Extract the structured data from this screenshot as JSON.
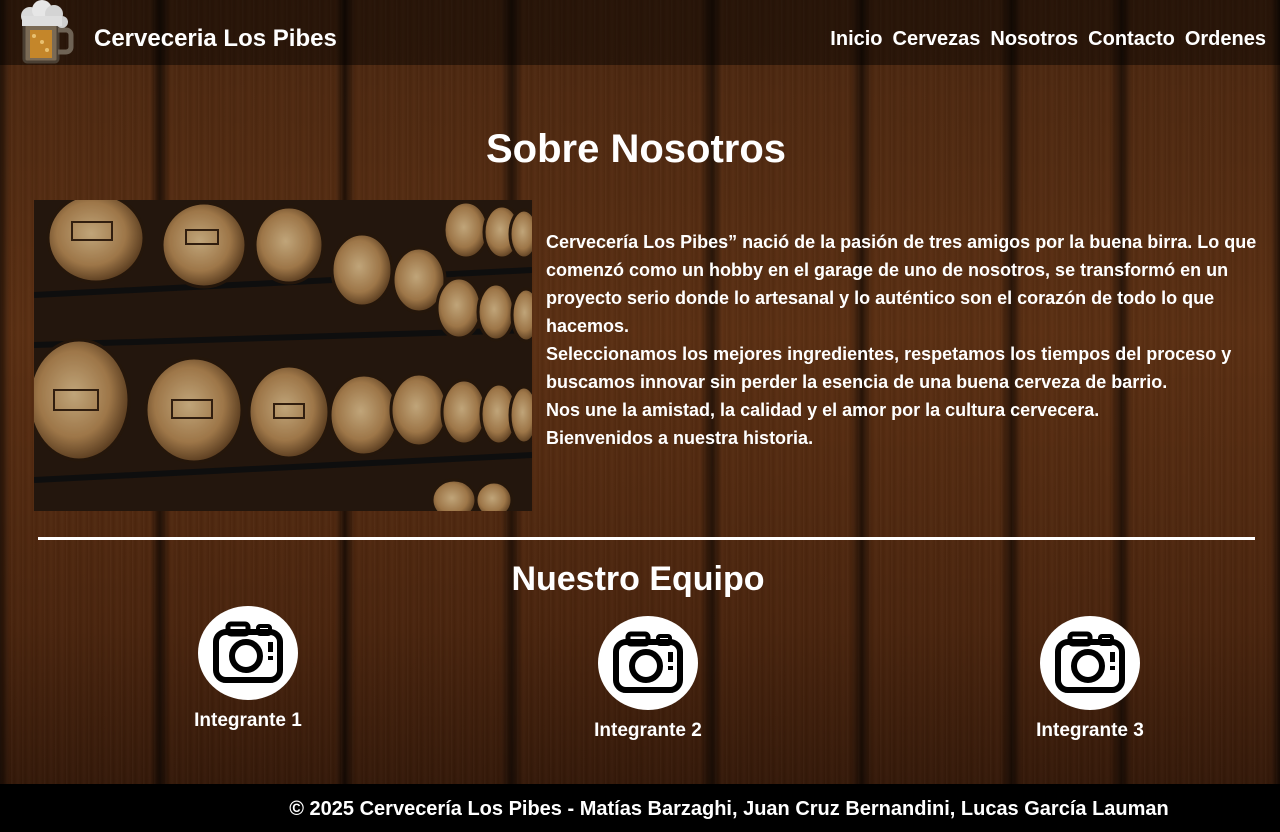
{
  "header": {
    "brand": "Cerveceria Los Pibes",
    "nav": [
      "Inicio",
      "Cervezas",
      "Nosotros",
      "Contacto",
      "Ordenes"
    ]
  },
  "about": {
    "title": "Sobre Nosotros",
    "paragraphs": [
      "Cervecería Los Pibes” nació de la pasión de tres amigos por la buena birra. Lo que comenzó como un hobby en el garage de uno de nosotros, se transformó en un proyecto serio donde lo artesanal y lo auténtico son el corazón de todo lo que hacemos.",
      "Seleccionamos los mejores ingredientes, respetamos los tiempos del proceso y buscamos innovar sin perder la esencia de una buena cerveza de barrio.",
      "Nos une la amistad, la calidad y el amor por la cultura cervecera.",
      "Bienvenidos a nuestra historia."
    ]
  },
  "team": {
    "title": "Nuestro Equipo",
    "members": [
      {
        "name": "Integrante 1",
        "icon": "camera-icon"
      },
      {
        "name": "Integrante 2",
        "icon": "camera-icon"
      },
      {
        "name": "Integrante 3",
        "icon": "camera-icon"
      }
    ]
  },
  "footer": {
    "copyright": "© 2025 Cervecería Los Pibes - Matías Barzaghi, Juan Cruz Bernandini, Lucas García Lauman"
  },
  "colors": {
    "header_bg": "#000000",
    "footer_bg": "#000000",
    "wood": "#5b2f12",
    "text": "#ffffff"
  }
}
